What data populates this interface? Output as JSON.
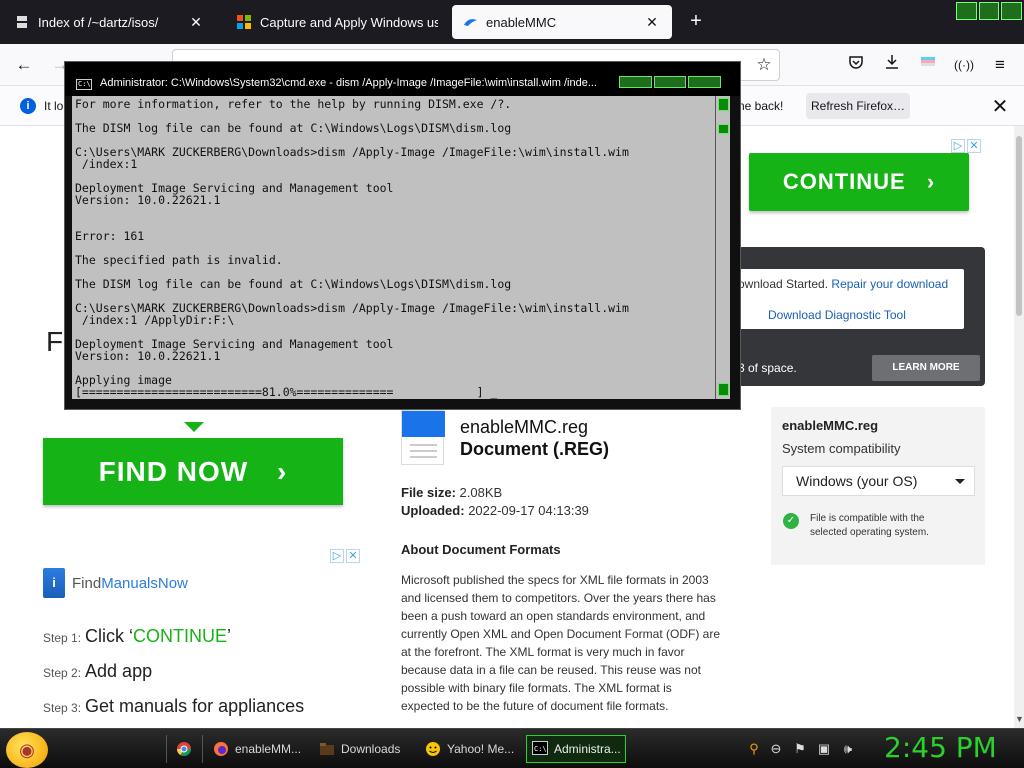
{
  "browser": {
    "tabs": [
      {
        "title": "Index of /~dartz/isos/",
        "icon": "server-icon"
      },
      {
        "title": "Capture and Apply Windows us",
        "icon": "windows-icon"
      },
      {
        "title": "enableMMC",
        "icon": "cloud-icon"
      }
    ],
    "new_tab_symbol": "+",
    "toolbar": {
      "back": "←",
      "forward": "→",
      "menu": "≡",
      "star": "☆"
    },
    "notification": {
      "text_left": "It lo",
      "text_right": "ne back!",
      "refresh_label": "Refresh Firefox…",
      "close": "✕"
    }
  },
  "cmd": {
    "title": "Administrator: C:\\Windows\\System32\\cmd.exe - dism  /Apply-Image /ImageFile:\\wim\\install.wim /inde...",
    "icon_text": "C:\\",
    "lines": [
      "For more information, refer to the help by running DISM.exe /?.",
      "",
      "The DISM log file can be found at C:\\Windows\\Logs\\DISM\\dism.log",
      "",
      "C:\\Users\\MARK ZUCKERBERG\\Downloads>dism /Apply-Image /ImageFile:\\wim\\install.wim",
      " /index:1",
      "",
      "Deployment Image Servicing and Management tool",
      "Version: 10.0.22621.1",
      "",
      "",
      "Error: 161",
      "",
      "The specified path is invalid.",
      "",
      "The DISM log file can be found at C:\\Windows\\Logs\\DISM\\dism.log",
      "",
      "C:\\Users\\MARK ZUCKERBERG\\Downloads>dism /Apply-Image /ImageFile:\\wim\\install.wim",
      " /index:1 /ApplyDir:F:\\",
      "",
      "Deployment Image Servicing and Management tool",
      "Version: 10.0.22621.1",
      "",
      "Applying image",
      "[==========================81.0%==============            ] _"
    ],
    "progress_percent": 81.0
  },
  "page": {
    "continue_label": "CONTINUE",
    "continue_arrow": "›",
    "download_started": "ownload Started.",
    "repair_link": "Repair your download",
    "diag_link": "Download Diagnostic Tool",
    "space_text": "3 of space.",
    "learn_more": "LEARN MORE",
    "big_letter": "F",
    "find_now": "FIND NOW",
    "find_now_arrow": "›",
    "fmn_brand_a": "Find",
    "fmn_brand_b": "ManualsNow",
    "fmn_icon_letter": "i",
    "steps": [
      {
        "num": "Step 1:",
        "pre": "Click ‘",
        "hl": "CONTINUE",
        "post": "’"
      },
      {
        "num": "Step 2:",
        "pre": "Add app",
        "hl": "",
        "post": ""
      },
      {
        "num": "Step 3:",
        "pre": "Get manuals for appliances",
        "hl": "",
        "post": ""
      }
    ],
    "file_name": "enableMMC.reg",
    "file_type": "Document (.REG)",
    "file_size_label": "File size:",
    "file_size": "2.08KB",
    "uploaded_label": "Uploaded:",
    "uploaded": "2022-09-17 04:13:39",
    "about_heading": "About Document Formats",
    "about_text": "Microsoft published the specs for XML file formats in 2003 and licensed them to competitors. Over the years there has been a push toward an open standards environment, and currently Open XML and Open Document Format (ODF) are at the forefront. The XML format is very much in favor because data in a file can be reused. This reuse was not possible with binary file formats. The XML format is expected to be the future of document file formats.",
    "compat_title": "enableMMC.reg",
    "compat_sub": "System compatibility",
    "os_value": "Windows (your OS)",
    "compat_note": "File is compatible with the selected operating system."
  },
  "taskbar": {
    "tasks": [
      {
        "label": "enableMM...",
        "icon": "firefox-icon"
      },
      {
        "label": "Downloads",
        "icon": "folder-icon"
      },
      {
        "label": "Yahoo! Me...",
        "icon": "yahoo-icon"
      },
      {
        "label": "Administra...",
        "icon": "cmd-icon"
      }
    ],
    "clock": "2:45 PM"
  },
  "colors": {
    "accent_green": "#16b316",
    "terminal_bg": "#c0c0c0",
    "clock_green": "#2ad12a",
    "link_blue": "#1a5fb4"
  }
}
